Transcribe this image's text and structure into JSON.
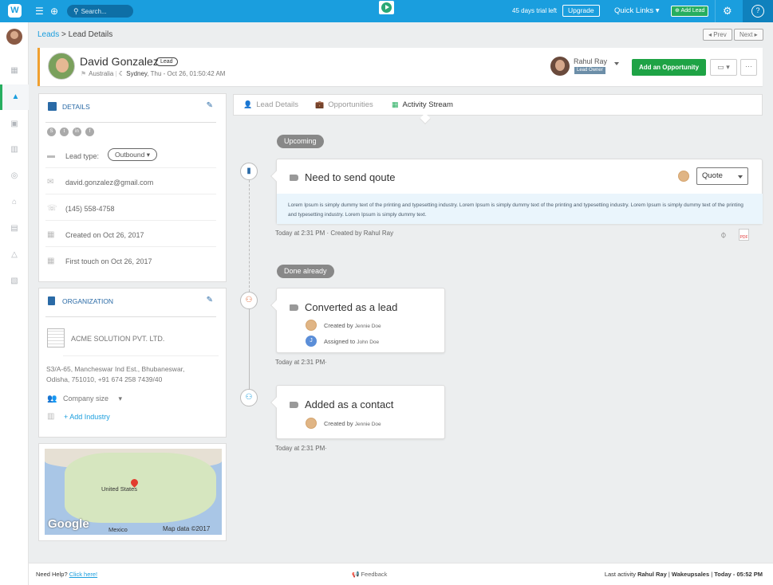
{
  "topbar": {
    "search_placeholder": "Search...",
    "trial_text": "45 days trial left",
    "upgrade_label": "Upgrade",
    "quick_links_label": "Quick Links ▾",
    "add_lead_label": "Add Lead",
    "help_label": "?",
    "brand_color": "#1a9ede"
  },
  "breadcrumb": {
    "root": "Leads",
    "separator": " > ",
    "current": "Lead Details"
  },
  "pager": {
    "prev_label": "Prev",
    "next_label": "Next"
  },
  "lead": {
    "name": "David Gonzalez",
    "tag": "Lead",
    "country": "Australia",
    "city": "Sydney",
    "local_time": ", Thu - Oct 26, 01:50:42 AM"
  },
  "owner": {
    "name": "Rahul Ray",
    "role": "Lead Owner"
  },
  "actions": {
    "add_opportunity_label": "Add an Opportunity"
  },
  "details": {
    "title": "DETAILS",
    "social_icons": [
      "skype-icon",
      "twitter-icon",
      "linkedin-icon",
      "facebook-icon"
    ],
    "lead_type_label": "Lead type:",
    "lead_type_value": "Outbound",
    "email": "david.gonzalez@gmail.com",
    "phone": "(145) 558-4758",
    "created": "Created on Oct 26, 2017",
    "first_touch": "First touch on Oct 26, 2017"
  },
  "organization": {
    "title": "ORGANIZATION",
    "name": "ACME SOLUTION PVT. LTD.",
    "address_line1": "S3/A-65, Mancheswar Ind Est., Bhubaneswar,",
    "address_line2": "Odisha, 751010, +91 674 258 7439/40",
    "company_size_label": "Company size",
    "add_industry_label": "+ Add Industry"
  },
  "map": {
    "label_us": "United States",
    "label_mexico": "Mexico",
    "attribution": "Map data ©2017",
    "brand": "Google"
  },
  "tabs": [
    {
      "label": "Lead Details"
    },
    {
      "label": "Opportunities"
    },
    {
      "label": "Activity Stream"
    }
  ],
  "timeline": {
    "upcoming_label": "Upcoming",
    "done_label": "Done already",
    "upcoming_activity": {
      "title": "Need to send qoute",
      "type_value": "Quote",
      "description": "Lorem Ipsum is simply dummy text of the printing and typesetting industry. Lorem Ipsum is simply dummy text of the printing and typesetting industry. Lorem Ipsum is simply dummy text of the printing and typesetting industry. Lorem Ipsum is simply dummy text.",
      "meta": "Today at 2:31 PM · Created by Rahul Ray"
    },
    "activity1": {
      "title": "Converted as a lead",
      "created_label": "Created by",
      "created_by": "Jennie Doe",
      "assigned_label": "Assigned to",
      "assigned_to": "John Doe",
      "assignee_initial": "J",
      "time": "Today at 2:31 PM·"
    },
    "activity2": {
      "title": "Added as a contact",
      "created_label": "Created by",
      "created_by": "Jennie Doe",
      "time": "Today at 2:31 PM·"
    }
  },
  "footer": {
    "need_help": "Need Help?",
    "click_here": "Click here!",
    "feedback": "Feedback",
    "last_activity_label": "Last activity",
    "last_activity_user": "Rahul Ray",
    "last_activity_org": "Wakeupsales",
    "last_activity_time": "Today - 05:52 PM"
  }
}
